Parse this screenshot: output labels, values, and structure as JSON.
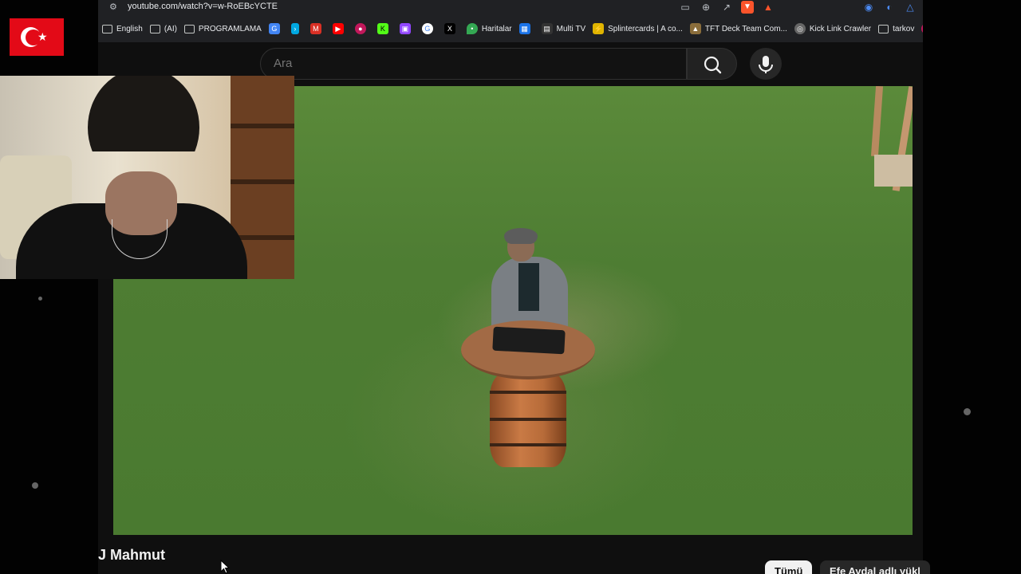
{
  "browser": {
    "url": "youtube.com/watch?v=w-RoEBcYCTE",
    "bookmarks": [
      {
        "label": "English",
        "icon": "folder-icon"
      },
      {
        "label": "(AI)",
        "icon": "folder-icon"
      },
      {
        "label": "PROGRAMLAMA",
        "icon": "folder-icon"
      },
      {
        "label": "",
        "icon": "translate-icon"
      },
      {
        "label": "",
        "icon": "prime-video-icon"
      },
      {
        "label": "",
        "icon": "gmail-icon"
      },
      {
        "label": "",
        "icon": "youtube-icon"
      },
      {
        "label": "",
        "icon": "app-red-icon"
      },
      {
        "label": "",
        "icon": "kick-icon"
      },
      {
        "label": "",
        "icon": "twitch-icon"
      },
      {
        "label": "",
        "icon": "google-icon"
      },
      {
        "label": "",
        "icon": "x-icon"
      },
      {
        "label": "Haritalar",
        "icon": "maps-icon"
      },
      {
        "label": "",
        "icon": "calendar-icon"
      },
      {
        "label": "Multi TV",
        "icon": "page-icon"
      },
      {
        "label": "Splintercards | A co...",
        "icon": "splinter-icon"
      },
      {
        "label": "TFT Deck Team Com...",
        "icon": "tft-icon"
      },
      {
        "label": "Kick Link Crawler",
        "icon": "globe-icon"
      },
      {
        "label": "tarkov",
        "icon": "folder-icon"
      }
    ]
  },
  "youtube": {
    "search_placeholder": "Ara",
    "video_title": "J Mahmut",
    "chips": [
      "Tümü",
      "Efe Aydal adlı yükl"
    ]
  },
  "colors": {
    "flag_red": "#e30a17",
    "chip_active_bg": "#f1f1f1",
    "yt_bg": "#0f0f0f"
  }
}
